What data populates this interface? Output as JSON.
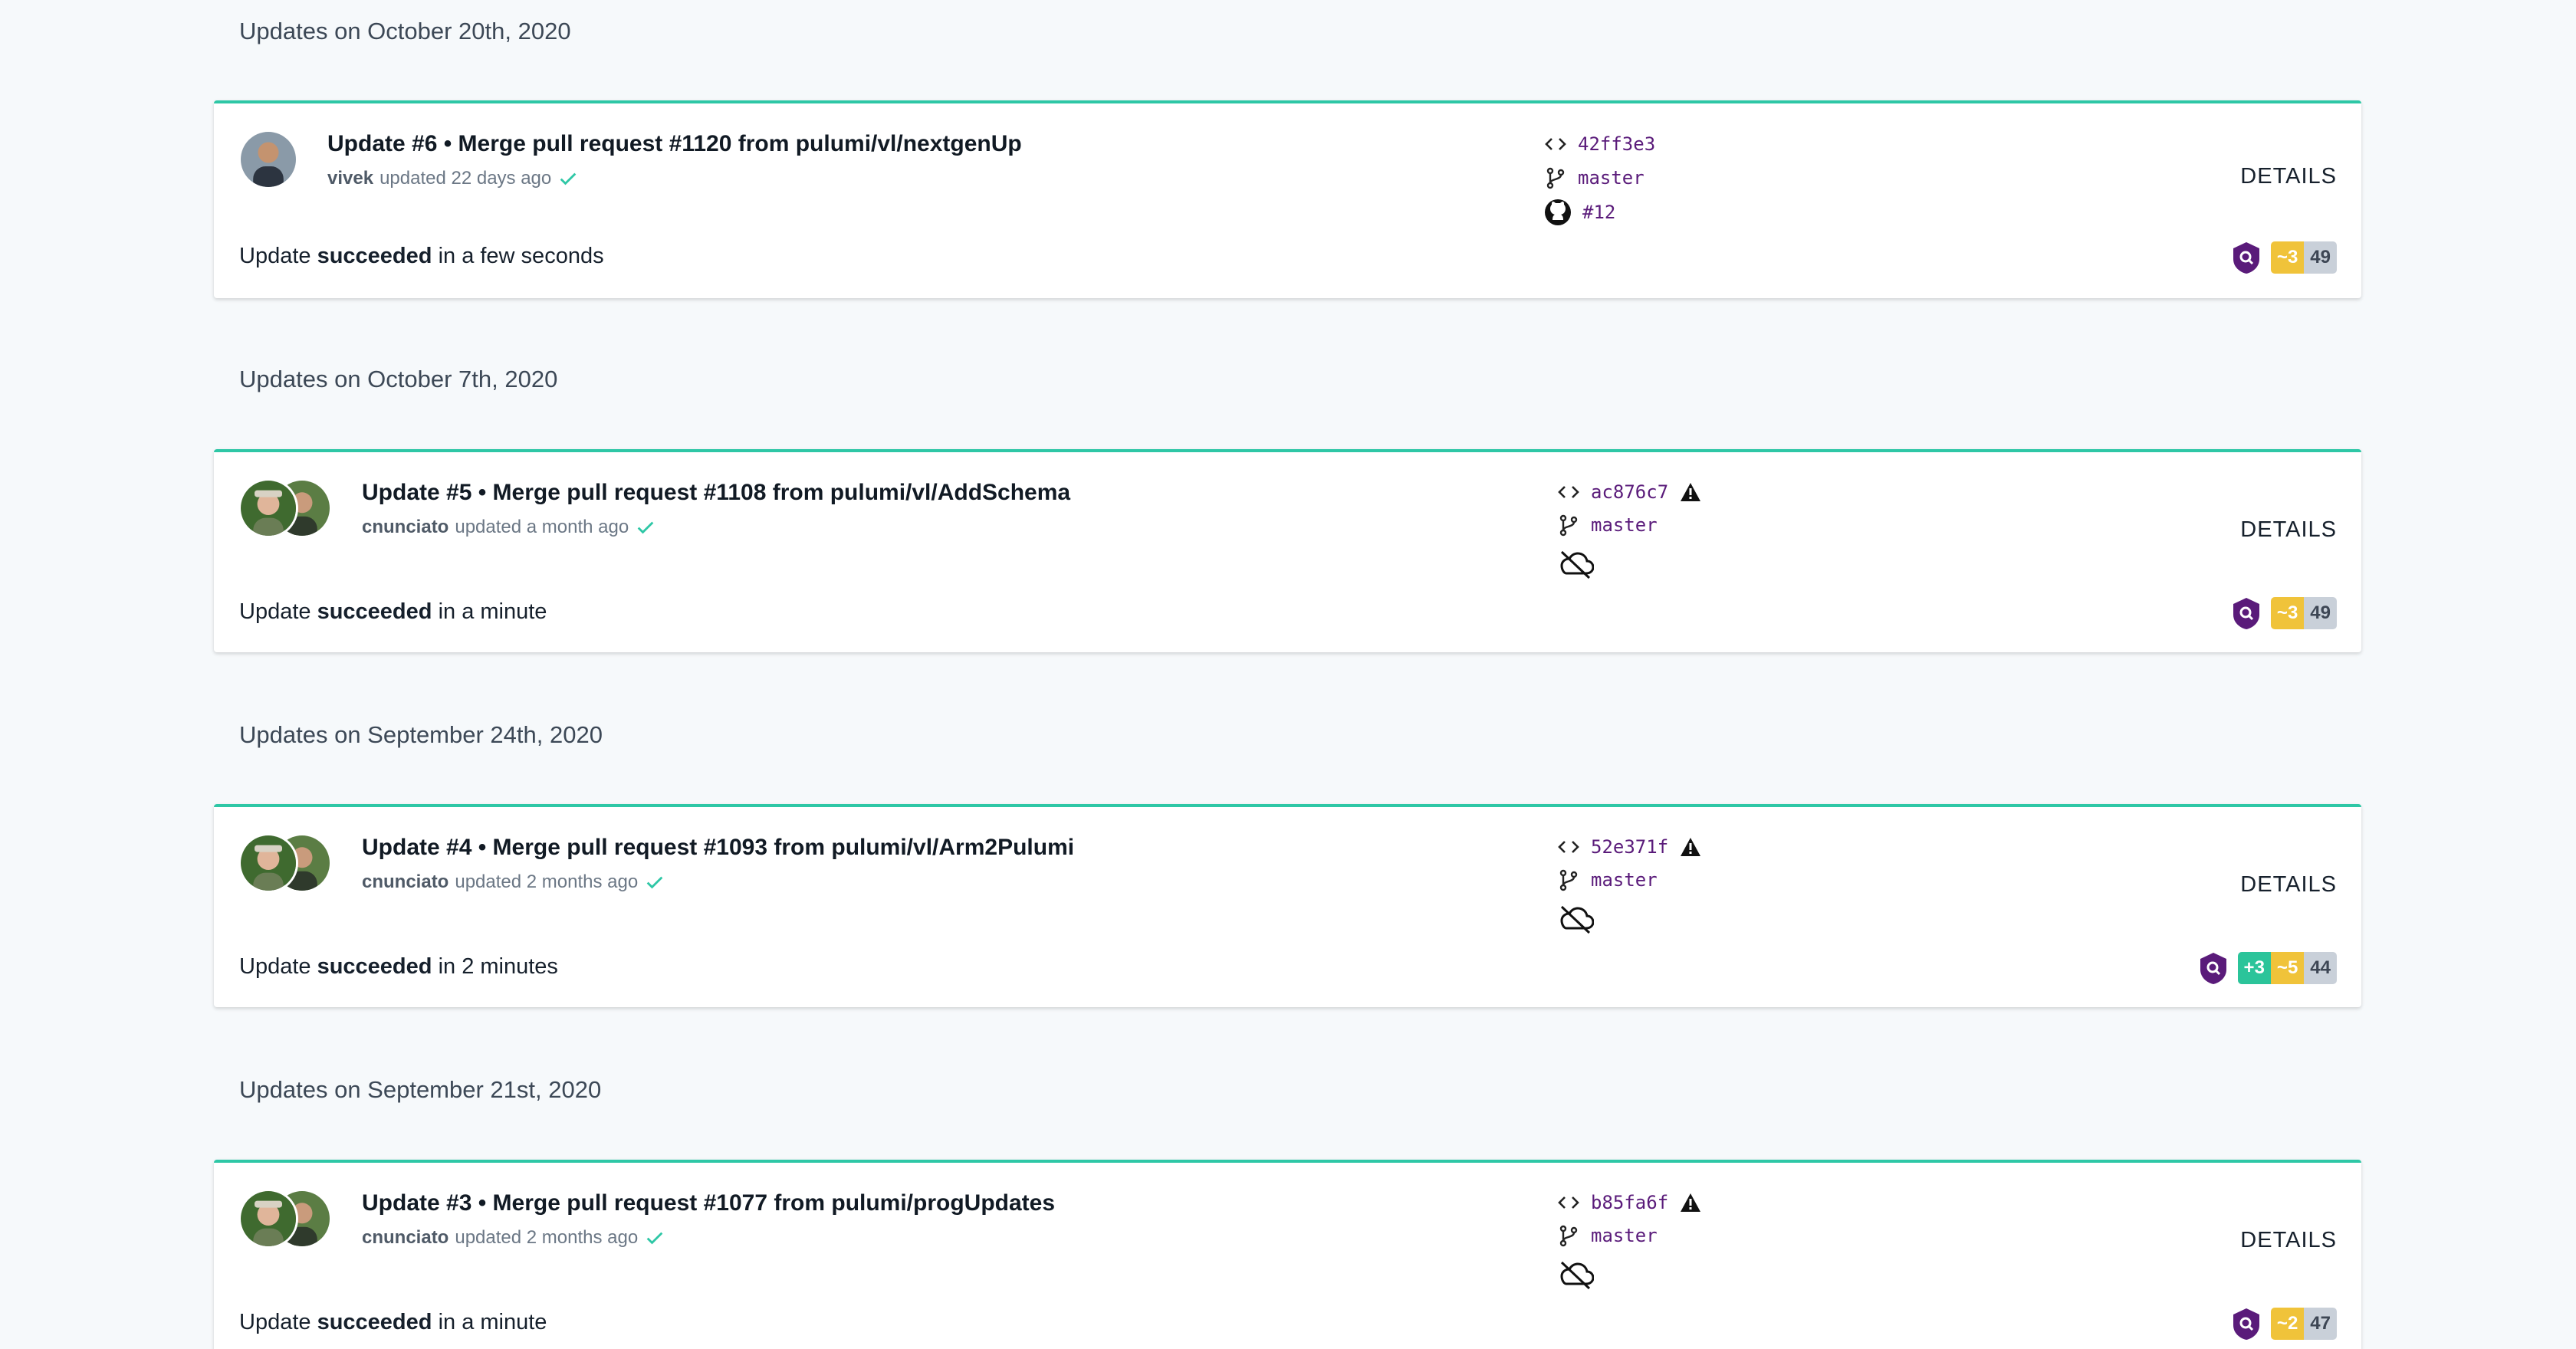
{
  "groups": [
    {
      "date_label": "Updates on October 20th, 2020",
      "update": {
        "title": "Update #6 • Merge pull request #1120 from pulumi/vl/nextgenUp",
        "user": "vivek",
        "updated_text": "updated 22 days ago",
        "result_prefix": "Update",
        "result_status": "succeeded",
        "result_suffix": "in a few seconds",
        "commit": "42ff3e3",
        "branch": "master",
        "pr": "#12",
        "details_label": "DETAILS",
        "changes": {
          "create": "",
          "update": "~3",
          "same": "49"
        }
      }
    },
    {
      "date_label": "Updates on October 7th, 2020",
      "update": {
        "title": "Update #5 • Merge pull request #1108 from pulumi/vl/AddSchema",
        "user": "cnunciato",
        "updated_text": "updated a month ago",
        "result_prefix": "Update",
        "result_status": "succeeded",
        "result_suffix": "in a minute",
        "commit": "ac876c7",
        "branch": "master",
        "details_label": "DETAILS",
        "changes": {
          "create": "",
          "update": "~3",
          "same": "49"
        }
      }
    },
    {
      "date_label": "Updates on September 24th, 2020",
      "update": {
        "title": "Update #4 • Merge pull request #1093 from pulumi/vl/Arm2Pulumi",
        "user": "cnunciato",
        "updated_text": "updated 2 months ago",
        "result_prefix": "Update",
        "result_status": "succeeded",
        "result_suffix": "in 2 minutes",
        "commit": "52e371f",
        "branch": "master",
        "details_label": "DETAILS",
        "changes": {
          "create": "+3",
          "update": "~5",
          "same": "44"
        }
      }
    },
    {
      "date_label": "Updates on September 21st, 2020",
      "update": {
        "title": "Update #3 • Merge pull request #1077 from pulumi/progUpdates",
        "user": "cnunciato",
        "updated_text": "updated 2 months ago",
        "result_prefix": "Update",
        "result_status": "succeeded",
        "result_suffix": "in a minute",
        "commit": "b85fa6f",
        "branch": "master",
        "details_label": "DETAILS",
        "changes": {
          "create": "",
          "update": "~2",
          "same": "47"
        }
      }
    }
  ],
  "icons": {
    "commit": "code-brackets-icon",
    "branch": "git-branch-icon",
    "pr": "github-icon",
    "warning": "warning-triangle-icon",
    "no-cloud": "cloud-off-icon",
    "success": "checkmark-icon",
    "policy": "shield-icon"
  },
  "colors": {
    "accent": "#2ec7a6",
    "link": "#5a1b7a",
    "create": "#2bc49a",
    "update": "#f0c33a",
    "same": "#c9d0d9"
  }
}
